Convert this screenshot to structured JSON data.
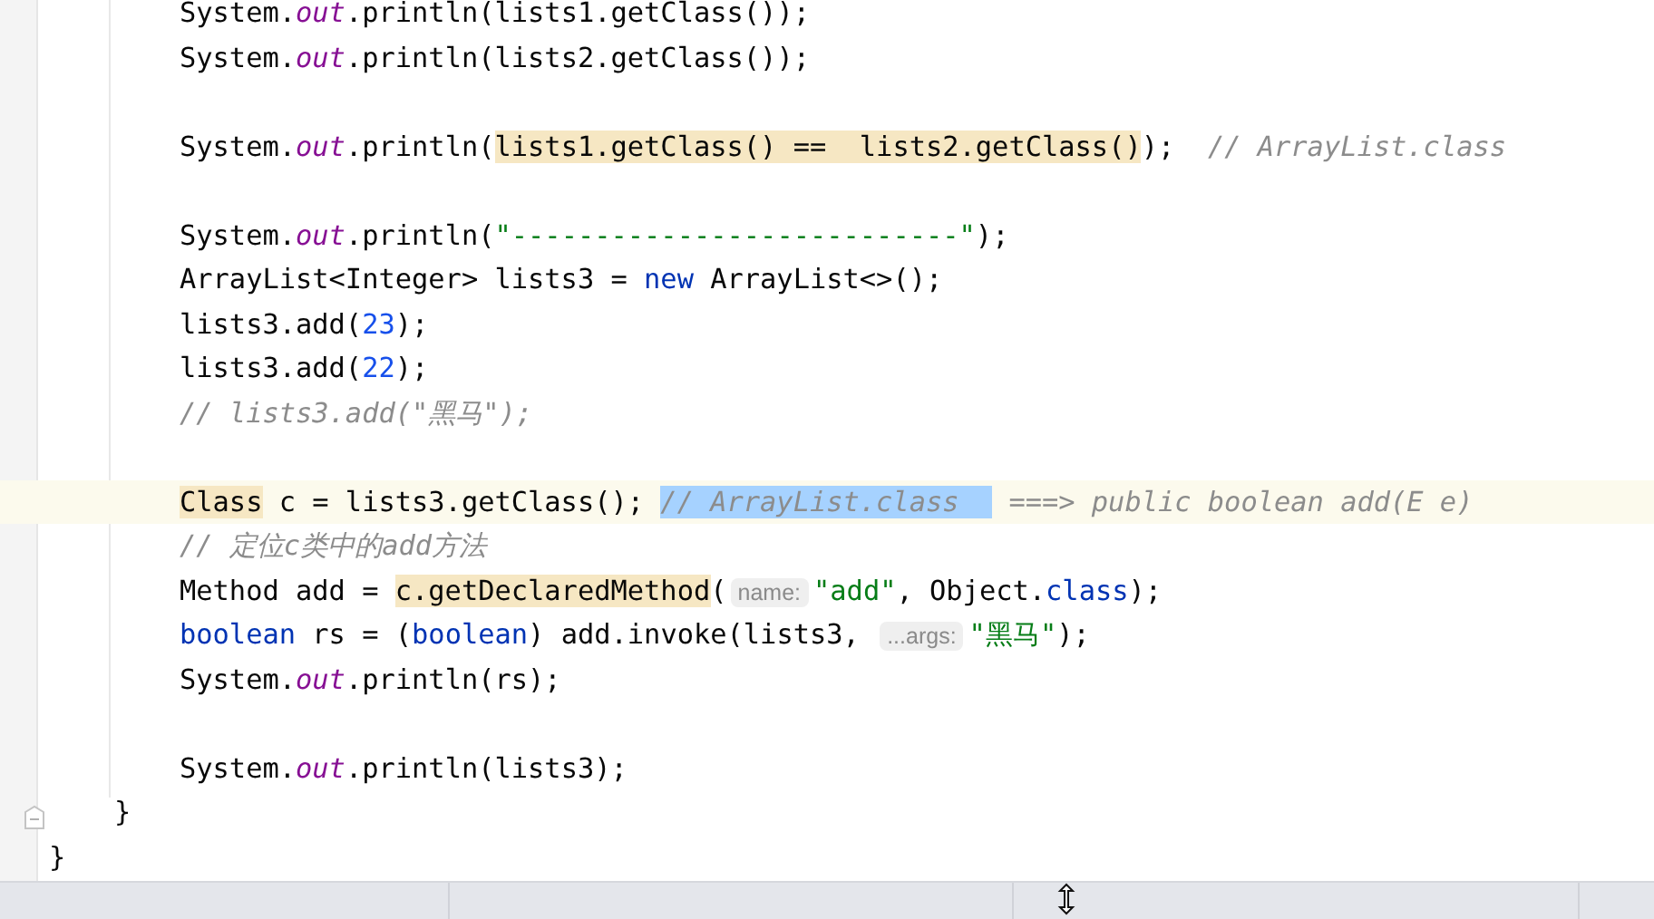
{
  "editor": {
    "lines": [
      {
        "current": false,
        "kind": "statement",
        "tokens": [
          {
            "t": "System.",
            "kind": "plain"
          },
          {
            "t": "out",
            "kind": "field"
          },
          {
            "t": ".println(lists1.getClass());",
            "kind": "plain"
          }
        ]
      },
      {
        "current": false,
        "kind": "statement",
        "tokens": [
          {
            "t": "System.",
            "kind": "plain"
          },
          {
            "t": "out",
            "kind": "field"
          },
          {
            "t": ".println(lists2.getClass());",
            "kind": "plain"
          }
        ]
      },
      {
        "current": false,
        "kind": "statement"
      },
      {
        "current": false,
        "kind": "statement",
        "tokens": [
          {
            "t": "System.",
            "kind": "plain"
          },
          {
            "t": "out",
            "kind": "field"
          },
          {
            "t": ".println(",
            "kind": "plain"
          },
          {
            "t": "lists1.getClass() ==  lists2.getClass()",
            "kind": "usage"
          },
          {
            "t": ");  ",
            "kind": "plain"
          },
          {
            "t": "// ArrayList.class",
            "kind": "comment"
          }
        ]
      },
      {
        "current": false,
        "kind": "statement"
      },
      {
        "current": false,
        "kind": "statement",
        "tokens": [
          {
            "t": "System.",
            "kind": "plain"
          },
          {
            "t": "out",
            "kind": "field"
          },
          {
            "t": ".println(",
            "kind": "plain"
          },
          {
            "t": "\"---------------------------\"",
            "kind": "string"
          },
          {
            "t": ");",
            "kind": "plain"
          }
        ]
      },
      {
        "current": false,
        "kind": "statement",
        "tokens": [
          {
            "t": "ArrayList<Integer> lists3 = ",
            "kind": "plain"
          },
          {
            "t": "new",
            "kind": "keyword"
          },
          {
            "t": " ArrayList<>();",
            "kind": "plain"
          }
        ]
      },
      {
        "current": false,
        "kind": "statement",
        "tokens": [
          {
            "t": "lists3.add(",
            "kind": "plain"
          },
          {
            "t": "23",
            "kind": "number"
          },
          {
            "t": ");",
            "kind": "plain"
          }
        ]
      },
      {
        "current": false,
        "kind": "statement",
        "tokens": [
          {
            "t": "lists3.add(",
            "kind": "plain"
          },
          {
            "t": "22",
            "kind": "number"
          },
          {
            "t": ");",
            "kind": "plain"
          }
        ]
      },
      {
        "current": false,
        "kind": "statement",
        "tokens": [
          {
            "t": "// lists3.add(\"黑马\");",
            "kind": "comment"
          }
        ]
      },
      {
        "current": false,
        "kind": "statement"
      },
      {
        "current": true,
        "kind": "statement",
        "tokens": [
          {
            "t": "Class",
            "kind": "usage"
          },
          {
            "t": " c = lists3.getClass(); ",
            "kind": "plain"
          },
          {
            "t": "// ArrayList.class  ",
            "kind": "selected_comment"
          },
          {
            "t": " ===> public boolean add(E e)",
            "kind": "comment"
          }
        ]
      },
      {
        "current": false,
        "kind": "statement",
        "tokens": [
          {
            "t": "// 定位c类中的add方法",
            "kind": "comment"
          }
        ]
      },
      {
        "current": false,
        "kind": "statement",
        "tokens": [
          {
            "t": "Method add = ",
            "kind": "plain"
          },
          {
            "t": "c.getDeclaredMethod",
            "kind": "usage"
          },
          {
            "t": "(",
            "kind": "plain"
          },
          {
            "t": "name:",
            "kind": "hint"
          },
          {
            "t": "\"add\"",
            "kind": "string"
          },
          {
            "t": ", Object.",
            "kind": "plain"
          },
          {
            "t": "class",
            "kind": "keyword"
          },
          {
            "t": ");",
            "kind": "plain"
          }
        ]
      },
      {
        "current": false,
        "kind": "statement",
        "tokens": [
          {
            "t": "boolean",
            "kind": "keyword"
          },
          {
            "t": " rs = (",
            "kind": "plain"
          },
          {
            "t": "boolean",
            "kind": "keyword"
          },
          {
            "t": ") add.invoke(lists3, ",
            "kind": "plain"
          },
          {
            "t": "...args:",
            "kind": "hint"
          },
          {
            "t": "\"黑马\"",
            "kind": "string"
          },
          {
            "t": ");",
            "kind": "plain"
          }
        ]
      },
      {
        "current": false,
        "kind": "statement",
        "tokens": [
          {
            "t": "System.",
            "kind": "plain"
          },
          {
            "t": "out",
            "kind": "field"
          },
          {
            "t": ".println(rs);",
            "kind": "plain"
          }
        ]
      },
      {
        "current": false,
        "kind": "statement"
      },
      {
        "current": false,
        "kind": "statement",
        "tokens": [
          {
            "t": "System.",
            "kind": "plain"
          },
          {
            "t": "out",
            "kind": "field"
          },
          {
            "t": ".println(lists3);",
            "kind": "plain"
          }
        ]
      },
      {
        "current": false,
        "kind": "method_end",
        "tokens": [
          {
            "t": "}",
            "kind": "plain"
          }
        ]
      },
      {
        "current": false,
        "kind": "class_end",
        "tokens": [
          {
            "t": "}",
            "kind": "plain"
          }
        ]
      }
    ]
  }
}
